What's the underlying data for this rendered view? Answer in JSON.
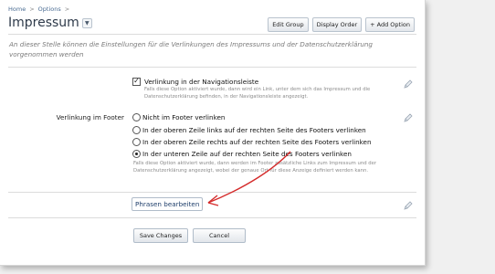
{
  "breadcrumb": {
    "home": "Home",
    "options": "Options",
    "sep": ">"
  },
  "page": {
    "title": "Impressum"
  },
  "toolbar": {
    "edit_group": "Edit Group",
    "display_order": "Display Order",
    "add_option": "+ Add Option"
  },
  "description": "An dieser Stelle können die Einstellungen für die Verlinkungen des Impressums und der Datenschutzerklärung vorgenommen werden",
  "nav_option": {
    "label": "Verlinkung in der Navigationsleiste",
    "checked": true,
    "help": "Falls diese Option aktiviert wurde, dann wird ein Link, unter dem sich das Impressum und die Datenschutzerklärung befinden, in der Navigationsleiste angezeigt."
  },
  "footer_option": {
    "label": "Verlinkung im Footer",
    "options": [
      "Nicht im Footer verlinken",
      "In der oberen Zeile links auf der rechten Seite des Footers verlinken",
      "In der oberen Zeile rechts auf der rechten Seite des Footers verlinken",
      "In der unteren Zeile auf der rechten Seite des Footers verlinken"
    ],
    "selected_index": 3,
    "help": "Falls diese Option aktiviert wurde, dann werden im Footer zusätzliche Links zum Impressum und der Datenschutzerklärung angezeigt, wobei der genaue Ort für diese Anzeige definiert werden kann."
  },
  "phrases_button": "Phrasen bearbeiten",
  "actions": {
    "save": "Save Changes",
    "cancel": "Cancel"
  },
  "colors": {
    "annotation_arrow": "#d42a2a",
    "link": "#4a6c93"
  },
  "icons": {
    "edit": "pencil-icon",
    "title_menu": "chevron-down-icon"
  }
}
